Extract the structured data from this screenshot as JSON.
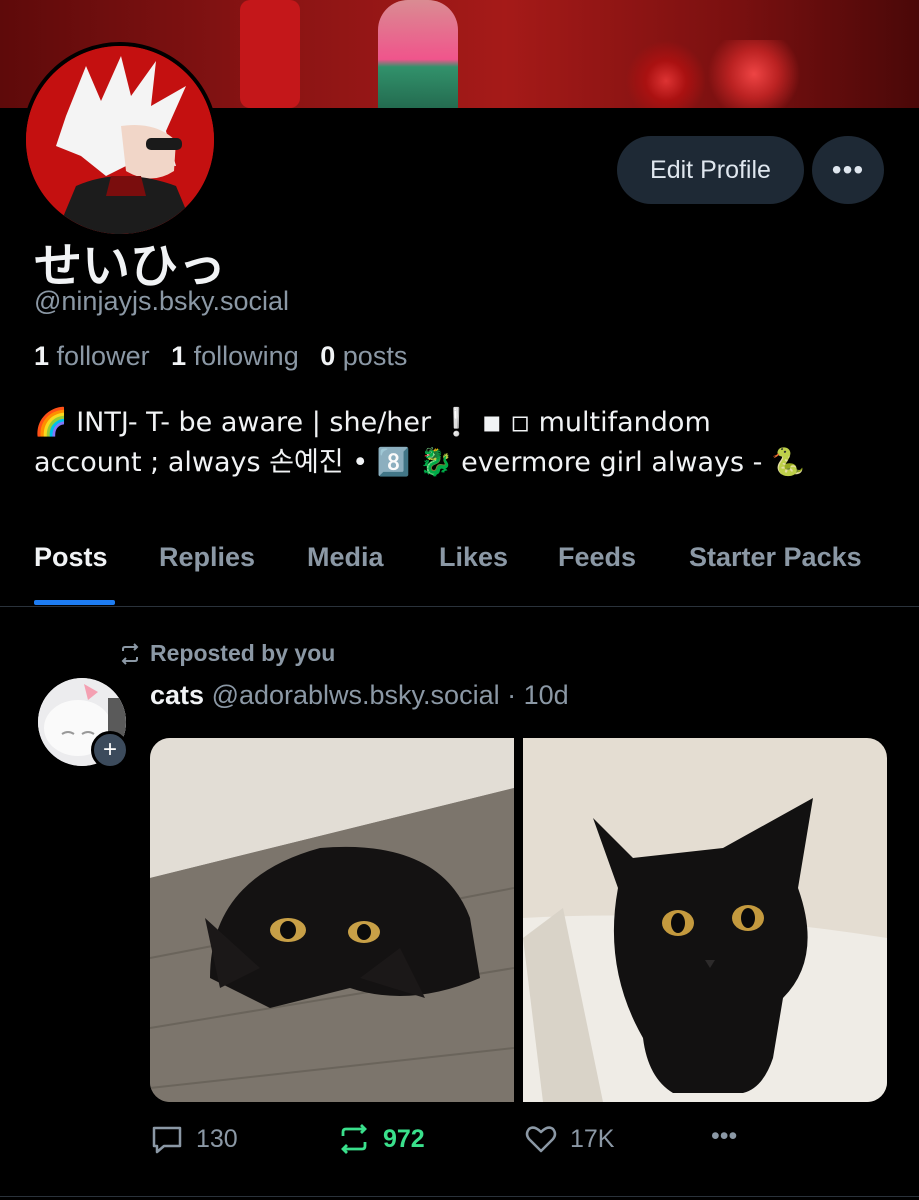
{
  "profile": {
    "display_name": "せいひっ",
    "handle": "@ninjayjs.bsky.social",
    "followers_count": "1",
    "followers_label": "follower",
    "following_count": "1",
    "following_label": "following",
    "posts_count": "0",
    "posts_label": "posts",
    "bio_line1": "🌈 INTJ- T- be aware | she/her ❕ ◾ ◽ multifandom",
    "bio_line2": "account ; always 손예진 • 8️⃣ 🐉 evermore girl always - 🐍",
    "edit_button": "Edit Profile",
    "more_button": "•••"
  },
  "tabs": [
    {
      "label": "Posts",
      "active": true
    },
    {
      "label": "Replies",
      "active": false
    },
    {
      "label": "Media",
      "active": false
    },
    {
      "label": "Likes",
      "active": false
    },
    {
      "label": "Feeds",
      "active": false
    },
    {
      "label": "Starter Packs",
      "active": false
    }
  ],
  "post": {
    "repost_label": "Reposted by you",
    "author_name": "cats",
    "author_handle": "@adorablws.bsky.social",
    "separator": "·",
    "time": "10d",
    "plus_badge": "+",
    "replies": "130",
    "reposts": "972",
    "likes": "17K",
    "more": "•••"
  },
  "colors": {
    "background": "#000000",
    "accent": "#1d7cf2",
    "repost_green": "#3ae08c",
    "muted": "#8b98a5",
    "button_bg": "#1e2935"
  },
  "icons": [
    "repost-icon",
    "reply-icon",
    "heart-icon",
    "more-icon",
    "plus-icon"
  ]
}
